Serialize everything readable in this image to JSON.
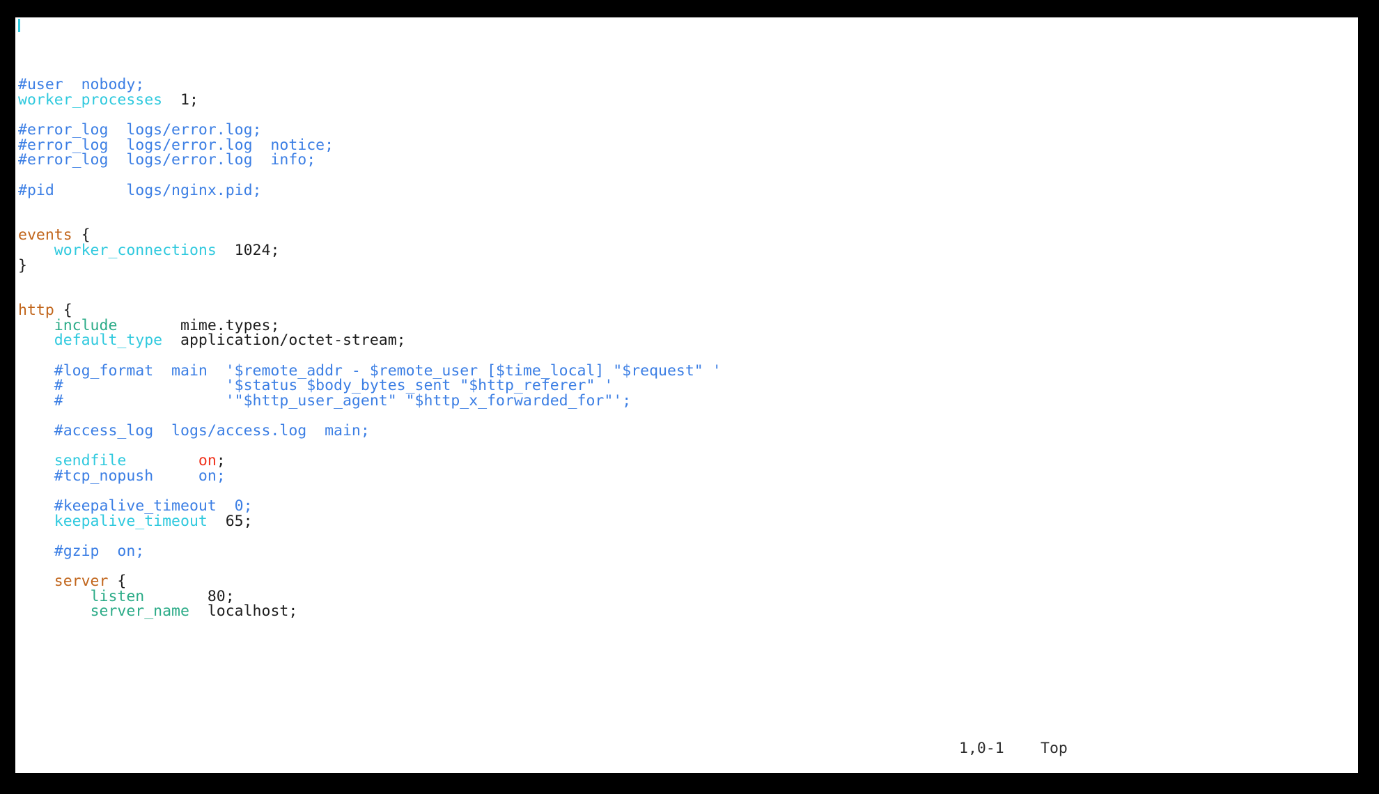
{
  "window": {
    "background_color": "#000000",
    "editor_background": "#ffffff"
  },
  "editor": {
    "app": "vim",
    "file_type": "nginx.conf",
    "cursor": {
      "visible": true,
      "line": 1,
      "column": 0
    },
    "status": {
      "ruler": "1,0-1",
      "scroll_position": "Top"
    },
    "colors": {
      "comment": "#3b7ee4",
      "directive": "#2fc9de",
      "directive_alt": "#2bab87",
      "block_keyword": "#c1651b",
      "boolean": "#f0301a",
      "plain": "#1d1d1d",
      "cursor": "#2fc9de"
    },
    "lines": [
      {
        "tokens": []
      },
      {
        "tokens": [
          {
            "t": "#user  nobody;",
            "c": "comment"
          }
        ]
      },
      {
        "tokens": [
          {
            "t": "worker_processes",
            "c": "directive"
          },
          {
            "t": "  1;",
            "c": "plain"
          }
        ]
      },
      {
        "tokens": []
      },
      {
        "tokens": [
          {
            "t": "#error_log  logs/error.log;",
            "c": "comment"
          }
        ]
      },
      {
        "tokens": [
          {
            "t": "#error_log  logs/error.log  notice;",
            "c": "comment"
          }
        ]
      },
      {
        "tokens": [
          {
            "t": "#error_log  logs/error.log  info;",
            "c": "comment"
          }
        ]
      },
      {
        "tokens": []
      },
      {
        "tokens": [
          {
            "t": "#pid        logs/nginx.pid;",
            "c": "comment"
          }
        ]
      },
      {
        "tokens": []
      },
      {
        "tokens": []
      },
      {
        "tokens": [
          {
            "t": "events",
            "c": "block"
          },
          {
            "t": " {",
            "c": "plain"
          }
        ]
      },
      {
        "tokens": [
          {
            "t": "    ",
            "c": "plain"
          },
          {
            "t": "worker_connections",
            "c": "directive"
          },
          {
            "t": "  1024;",
            "c": "plain"
          }
        ]
      },
      {
        "tokens": [
          {
            "t": "}",
            "c": "plain"
          }
        ]
      },
      {
        "tokens": []
      },
      {
        "tokens": []
      },
      {
        "tokens": [
          {
            "t": "http",
            "c": "block"
          },
          {
            "t": " {",
            "c": "plain"
          }
        ]
      },
      {
        "tokens": [
          {
            "t": "    ",
            "c": "plain"
          },
          {
            "t": "include",
            "c": "directive_alt"
          },
          {
            "t": "       mime.types;",
            "c": "plain"
          }
        ]
      },
      {
        "tokens": [
          {
            "t": "    ",
            "c": "plain"
          },
          {
            "t": "default_type",
            "c": "directive"
          },
          {
            "t": "  application/octet-stream;",
            "c": "plain"
          }
        ]
      },
      {
        "tokens": []
      },
      {
        "tokens": [
          {
            "t": "    #log_format  main  '$remote_addr - $remote_user [$time_local] \"$request\" '",
            "c": "comment"
          }
        ]
      },
      {
        "tokens": [
          {
            "t": "    #                  '$status $body_bytes_sent \"$http_referer\" '",
            "c": "comment"
          }
        ]
      },
      {
        "tokens": [
          {
            "t": "    #                  '\"$http_user_agent\" \"$http_x_forwarded_for\"';",
            "c": "comment"
          }
        ]
      },
      {
        "tokens": []
      },
      {
        "tokens": [
          {
            "t": "    #access_log  logs/access.log  main;",
            "c": "comment"
          }
        ]
      },
      {
        "tokens": []
      },
      {
        "tokens": [
          {
            "t": "    ",
            "c": "plain"
          },
          {
            "t": "sendfile",
            "c": "directive"
          },
          {
            "t": "        ",
            "c": "plain"
          },
          {
            "t": "on",
            "c": "boolean"
          },
          {
            "t": ";",
            "c": "plain"
          }
        ]
      },
      {
        "tokens": [
          {
            "t": "    #tcp_nopush     on;",
            "c": "comment"
          }
        ]
      },
      {
        "tokens": []
      },
      {
        "tokens": [
          {
            "t": "    #keepalive_timeout  0;",
            "c": "comment"
          }
        ]
      },
      {
        "tokens": [
          {
            "t": "    ",
            "c": "plain"
          },
          {
            "t": "keepalive_timeout",
            "c": "directive"
          },
          {
            "t": "  65;",
            "c": "plain"
          }
        ]
      },
      {
        "tokens": []
      },
      {
        "tokens": [
          {
            "t": "    #gzip  on;",
            "c": "comment"
          }
        ]
      },
      {
        "tokens": []
      },
      {
        "tokens": [
          {
            "t": "    ",
            "c": "plain"
          },
          {
            "t": "server",
            "c": "block"
          },
          {
            "t": " {",
            "c": "plain"
          }
        ]
      },
      {
        "tokens": [
          {
            "t": "        ",
            "c": "plain"
          },
          {
            "t": "listen",
            "c": "directive_alt"
          },
          {
            "t": "       80;",
            "c": "plain"
          }
        ]
      },
      {
        "tokens": [
          {
            "t": "        ",
            "c": "plain"
          },
          {
            "t": "server_name",
            "c": "directive_alt"
          },
          {
            "t": "  localhost;",
            "c": "plain"
          }
        ]
      }
    ]
  }
}
